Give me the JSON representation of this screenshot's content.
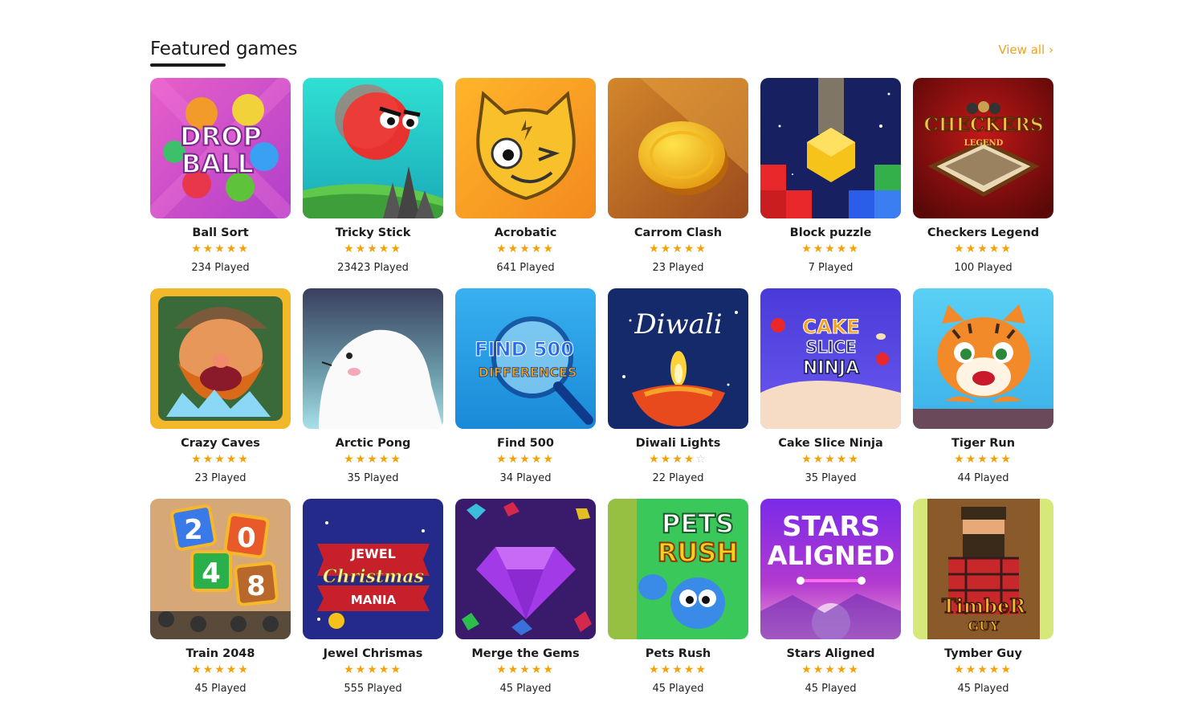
{
  "section": {
    "title": "Featured games",
    "view_all": "View all ›"
  },
  "colors": {
    "accent": "#f0a318",
    "star": "#f2a20c"
  },
  "games": [
    {
      "name": "Ball Sort",
      "rating": 5,
      "played": "234 Played",
      "art": "drop-ball",
      "art_text": [
        "DROP",
        "BALL"
      ]
    },
    {
      "name": "Tricky Stick",
      "rating": 5,
      "played": "23423 Played",
      "art": "red-ball"
    },
    {
      "name": "Acrobatic",
      "rating": 5,
      "played": "641 Played",
      "art": "yellow-cat"
    },
    {
      "name": "Carrom Clash",
      "rating": 5,
      "played": "23 Played",
      "art": "coin"
    },
    {
      "name": "Block puzzle",
      "rating": 5,
      "played": "7 Played",
      "art": "blocks"
    },
    {
      "name": "Checkers Legend",
      "rating": 5,
      "played": "100 Played",
      "art": "checkers",
      "art_text": [
        "CHECKERS",
        "LEGEND"
      ]
    },
    {
      "name": "Crazy Caves",
      "rating": 5,
      "played": "23 Played",
      "art": "miner"
    },
    {
      "name": "Arctic Pong",
      "rating": 5,
      "played": "35 Played",
      "art": "seal"
    },
    {
      "name": "Find 500",
      "rating": 5,
      "played": "34 Played",
      "art": "find",
      "art_text": [
        "FIND 500",
        "DIFFERENCES"
      ]
    },
    {
      "name": "Diwali Lights",
      "rating": 4,
      "played": "22 Played",
      "art": "diwali",
      "art_text": [
        "Diwali"
      ]
    },
    {
      "name": "Cake Slice Ninja",
      "rating": 5,
      "played": "35 Played",
      "art": "cake",
      "art_text": [
        "CAKE",
        "SLICE",
        "NINJA"
      ]
    },
    {
      "name": "Tiger Run",
      "rating": 5,
      "played": "44 Played",
      "art": "tiger"
    },
    {
      "name": "Train 2048",
      "rating": 5,
      "played": "45 Played",
      "art": "train",
      "art_text": [
        "2",
        "0",
        "4",
        "8"
      ]
    },
    {
      "name": "Jewel Chrismas",
      "rating": 5,
      "played": "555 Played",
      "art": "jewel",
      "art_text": [
        "JEWEL",
        "Christmas",
        "MANIA"
      ]
    },
    {
      "name": "Merge the Gems",
      "rating": 5,
      "played": "45 Played",
      "art": "gems"
    },
    {
      "name": "Pets Rush",
      "rating": 5,
      "played": "45 Played",
      "art": "pets",
      "art_text": [
        "PETS",
        "RUSH"
      ]
    },
    {
      "name": "Stars Aligned",
      "rating": 5,
      "played": "45 Played",
      "art": "stars",
      "art_text": [
        "STARS",
        "ALIGNED"
      ]
    },
    {
      "name": "Tymber Guy",
      "rating": 5,
      "played": "45 Played",
      "art": "timber",
      "art_text": [
        "TimbeR",
        "GUY"
      ]
    }
  ]
}
